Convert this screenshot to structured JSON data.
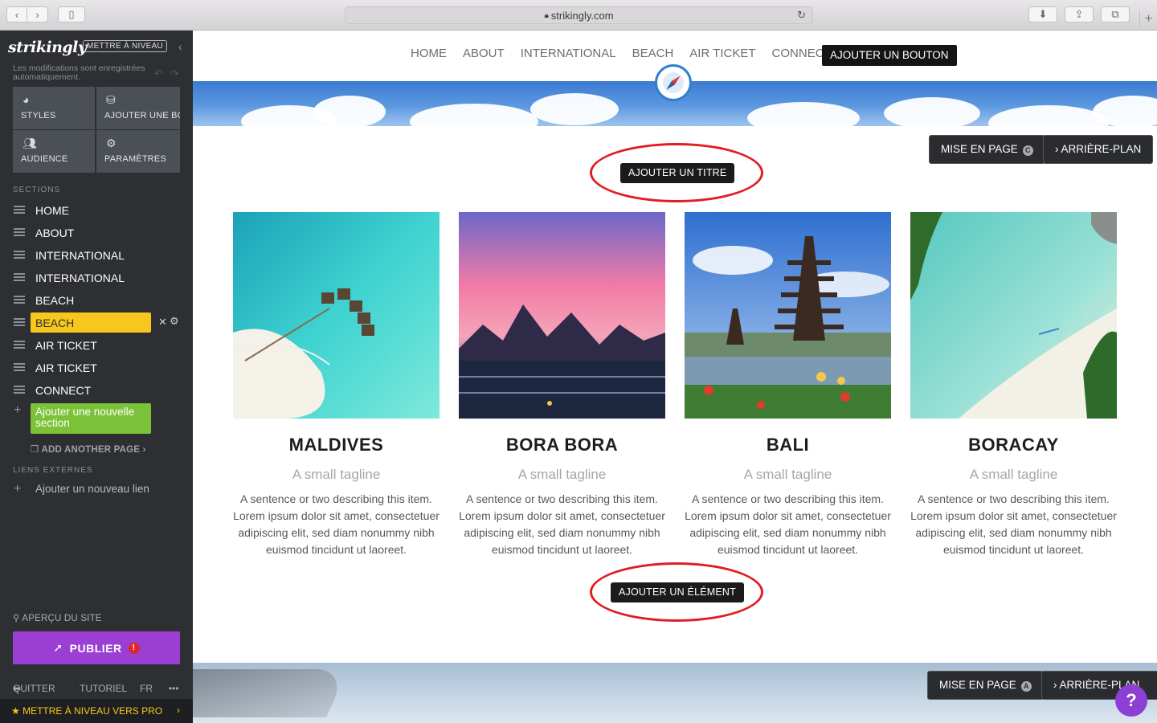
{
  "browser": {
    "url": "strikingly.com"
  },
  "sidebar": {
    "logo": "strikingly",
    "upgrade_badge": "METTRE À NIVEAU",
    "autosave": "Les modifications sont enregistrées automatiquement.",
    "tools": [
      {
        "label": "STYLES",
        "icon": "palette-icon"
      },
      {
        "label": "AJOUTER UNE BOUTIQUE",
        "icon": "store-icon"
      },
      {
        "label": "AUDIENCE",
        "icon": "users-icon"
      },
      {
        "label": "PARAMÈTRES",
        "icon": "gear-icon"
      }
    ],
    "sections_heading": "SECTIONS",
    "sections": [
      {
        "label": "HOME"
      },
      {
        "label": "ABOUT"
      },
      {
        "label": "INTERNATIONAL"
      },
      {
        "label": "INTERNATIONAL"
      },
      {
        "label": "BEACH"
      },
      {
        "label": "BEACH",
        "active": true
      },
      {
        "label": "AIR TICKET"
      },
      {
        "label": "AIR TICKET"
      },
      {
        "label": "CONNECT"
      }
    ],
    "add_section": "Ajouter une nouvelle section",
    "add_page": "ADD ANOTHER PAGE ›",
    "external_links_heading": "LIENS EXTERNES",
    "add_link": "Ajouter un nouveau lien",
    "preview": "APERÇU DU SITE",
    "publish": "PUBLIER",
    "footer": {
      "quit": "QUITTER",
      "tutorial": "TUTORIEL",
      "lang": "FR",
      "more": "•••"
    },
    "upgrade_pro": "METTRE À NIVEAU VERS PRO"
  },
  "site": {
    "nav": [
      "HOME",
      "ABOUT",
      "INTERNATIONAL",
      "BEACH",
      "AIR TICKET",
      "CONNECT"
    ],
    "nav_cta": "AJOUTER UN BOUTON",
    "layout_btn": "MISE EN PAGE",
    "layout_badge_top": "C",
    "layout_badge_bottom": "A",
    "background_btn": "ARRIÈRE-PLAN",
    "add_title": "AJOUTER UN TITRE",
    "add_element": "AJOUTER UN ÉLÉMENT",
    "cards": [
      {
        "name": "MALDIVES",
        "tagline": "A small tagline",
        "desc": "A sentence or two describing this item. Lorem ipsum dolor sit amet, consectetuer adipiscing elit, sed diam nonummy nibh euismod tincidunt ut laoreet."
      },
      {
        "name": "BORA BORA",
        "tagline": "A small tagline",
        "desc": "A sentence or two describing this item. Lorem ipsum dolor sit amet, consectetuer adipiscing elit, sed diam nonummy nibh euismod tincidunt ut laoreet."
      },
      {
        "name": "BALI",
        "tagline": "A small tagline",
        "desc": "A sentence or two describing this item. Lorem ipsum dolor sit amet, consectetuer adipiscing elit, sed diam nonummy nibh euismod tincidunt ut laoreet."
      },
      {
        "name": "BORACAY",
        "tagline": "A small tagline",
        "desc": "A sentence or two describing this item. Lorem ipsum dolor sit amet, consectetuer adipiscing elit, sed diam nonummy nibh euismod tincidunt ut laoreet."
      }
    ],
    "help": "?"
  },
  "colors": {
    "sidebar_bg": "#2d2f33",
    "active_section": "#f7c81b",
    "add_section": "#7bc238",
    "publish": "#9b3fd4",
    "annotation_ring": "#e11d23"
  }
}
